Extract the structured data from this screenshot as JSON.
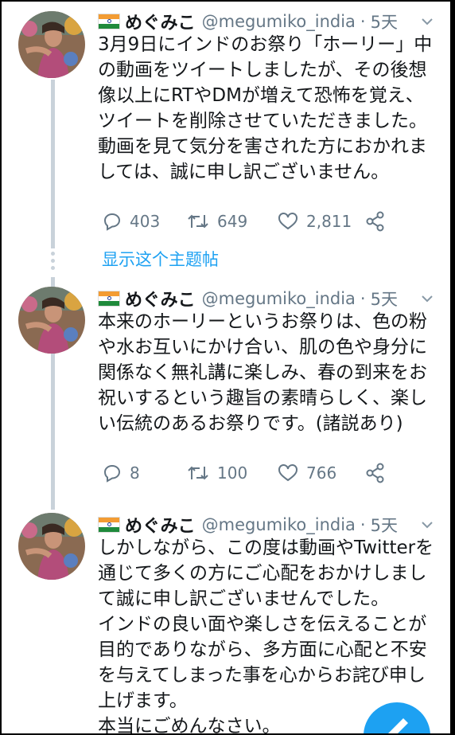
{
  "tweets": [
    {
      "flag": "🇮🇳",
      "name": "めぐみこ",
      "handle": "@megumiko_india",
      "separator": "·",
      "time": "5天",
      "text": "3月9日にインドのお祭り「ホーリー」中\nの動画をツイートしましたが、その後想\n像以上にRTやDMが増えて恐怖を覚え、\nツイートを削除させていただきました。\n動画を見て気分を害された方におかれま\nしては、誠に申し訳ございません。",
      "replies": "403",
      "retweets": "649",
      "likes": "2,811"
    },
    {
      "flag": "🇮🇳",
      "name": "めぐみこ",
      "handle": "@megumiko_india",
      "separator": "·",
      "time": "5天",
      "text": "本来のホーリーというお祭りは、色の粉\nや水お互いにかけ合い、肌の色や身分に\n関係なく無礼講に楽しみ、春の到来をお\n祝いするという趣旨の素晴らしく、楽し\nい伝統のあるお祭りです。(諸説あり)",
      "replies": "8",
      "retweets": "100",
      "likes": "766"
    },
    {
      "flag": "🇮🇳",
      "name": "めぐみこ",
      "handle": "@megumiko_india",
      "separator": "·",
      "time": "5天",
      "text": "しかしながら、この度は動画やTwitterを\n通じて多くの方にご心配をおかけしまし\nて誠に申し訳ございませんでした。\nインドの良い面や楽しさを伝えることが\n目的でありながら、多方面に心配と不安\nを与えてしまった事を心からお詫び申し\n上げます。\n本当にごめんなさい。"
    }
  ],
  "show_thread_label": "显示这个主题帖",
  "icons": {
    "reply": "reply-icon",
    "retweet": "retweet-icon",
    "like": "heart-icon",
    "share": "share-icon",
    "caret": "chevron-down-icon",
    "compose": "compose-icon"
  },
  "colors": {
    "accent": "#1da1f2",
    "secondary_text": "#657786",
    "thread_line": "#c9d2da"
  }
}
